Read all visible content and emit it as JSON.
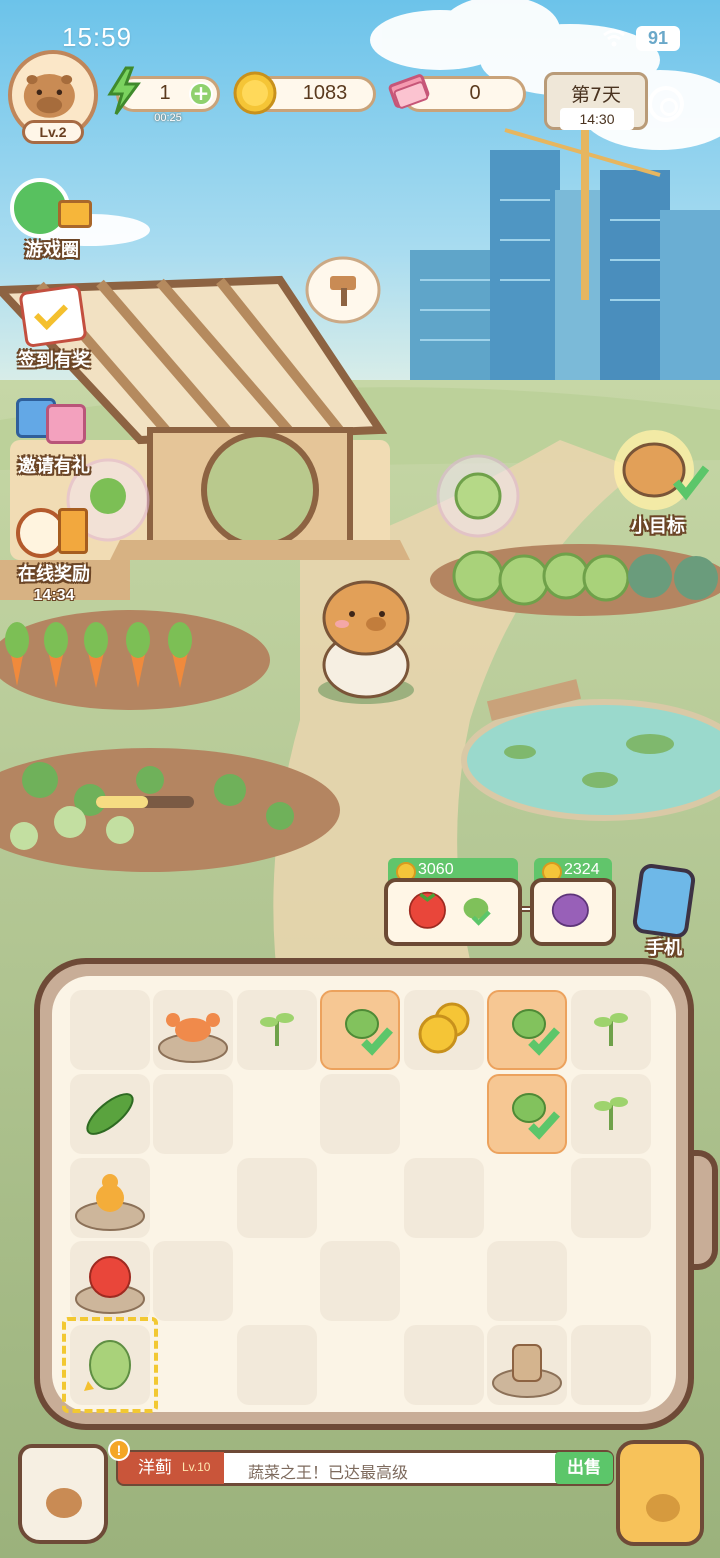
{
  "status_bar": {
    "time": "15:59",
    "battery": "91"
  },
  "player": {
    "level": "Lv.2"
  },
  "resources": {
    "energy": "1",
    "energy_timer": "00:25",
    "coins": "1083",
    "tickets": "0"
  },
  "day": {
    "label": "第7天",
    "time": "14:30"
  },
  "side_menu": [
    {
      "label": "游戏圈",
      "icon": "game-circle-icon"
    },
    {
      "label": "签到有奖",
      "icon": "calendar-checkin-icon"
    },
    {
      "label": "邀请有礼",
      "icon": "invite-gift-icon"
    },
    {
      "label": "在线奖励",
      "icon": "online-reward-icon",
      "timer": "14:34"
    }
  ],
  "goal": {
    "label": "小目标"
  },
  "orders": [
    {
      "price": "3060",
      "items": [
        "tomato",
        "seedling"
      ]
    },
    {
      "price": "2324",
      "items": [
        "onion"
      ]
    }
  ],
  "phone": {
    "label": "手机"
  },
  "selected_item": {
    "name": "洋蓟",
    "level": "Lv.10",
    "description": "蔬菜之王！已达最高级"
  },
  "sell_button": "出售",
  "colors": {
    "accent_green": "#5cc66a",
    "board_border": "#6e4a37",
    "highlight_orange": "#f6c793"
  }
}
